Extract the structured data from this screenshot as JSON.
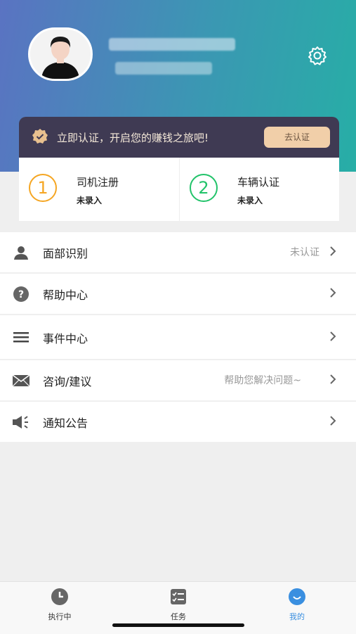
{
  "colors": {
    "accent_orange": "#f5a623",
    "accent_green": "#22c36a",
    "tab_active": "#3a8fe0"
  },
  "verify_banner": {
    "text": "立即认证，开启您的赚钱之旅吧!",
    "button_label": "去认证"
  },
  "steps": [
    {
      "number": "1",
      "title": "司机注册",
      "status": "未录入"
    },
    {
      "number": "2",
      "title": "车辆认证",
      "status": "未录入"
    }
  ],
  "menu": [
    {
      "label": "面部识别",
      "hint": "未认证",
      "icon": "person-icon"
    },
    {
      "label": "帮助中心",
      "hint": "",
      "icon": "question-icon"
    },
    {
      "label": "事件中心",
      "hint": "",
      "icon": "list-icon"
    },
    {
      "label": "咨询/建议",
      "hint": "帮助您解决问题~",
      "icon": "mail-icon"
    },
    {
      "label": "通知公告",
      "hint": "",
      "icon": "megaphone-icon"
    }
  ],
  "tabs": [
    {
      "label": "执行中",
      "icon": "clock-icon",
      "active": false
    },
    {
      "label": "任务",
      "icon": "tasks-icon",
      "active": false
    },
    {
      "label": "我的",
      "icon": "profile-icon",
      "active": true
    }
  ]
}
